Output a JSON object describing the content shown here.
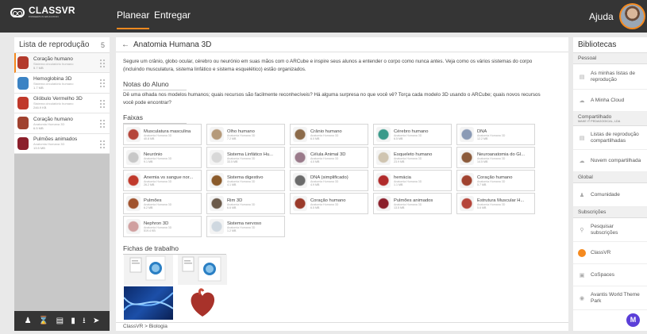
{
  "app": {
    "logo_text": "CLASSVR",
    "logo_subtitle": "PIONEERS IN EDUCATION"
  },
  "nav": {
    "tab_plan": "Planear",
    "tab_deliver": "Entregar",
    "help": "Ajuda"
  },
  "playlist": {
    "title": "Lista de reprodução",
    "count": "5",
    "items": [
      {
        "title": "Coração humano",
        "sub": "Sistema circulatório humano",
        "size": "5.7 MB",
        "color": "#b33a2c"
      },
      {
        "title": "Hemoglobina 3D",
        "sub": "Sistema circulatório humano",
        "size": "1.7 MB",
        "color": "#3b83c4"
      },
      {
        "title": "Glóbulo Vermelho 3D",
        "sub": "Sistema circulatório humano",
        "size": "246.9 KB",
        "color": "#c0392b"
      },
      {
        "title": "Coração humano",
        "sub": "Anatomia Humana 3D",
        "size": "6.5 MB",
        "color": "#a0422f"
      },
      {
        "title": "Pulmões animados",
        "sub": "Anatomia Humana 3D",
        "size": "13.5 MB",
        "color": "#8b1f2b"
      }
    ],
    "toolbar": [
      "person-icon",
      "hourglass-icon",
      "save-icon",
      "trash-icon",
      "download-icon",
      "send-icon"
    ]
  },
  "main": {
    "title": "Anatomia Humana 3D",
    "description": "Segure um crânio, globo ocular, cérebro ou neurónio em suas mãos com o ARCube e inspire seus alunos a entender o corpo como nunca antes. Veja como os vários sistemas do corpo (incluindo musculatura, sistema linfático e sistema esquelético) estão organizados.",
    "notes_title": "Notas do Aluno",
    "notes": "Dê uma olhada nos modelos humanos; quais recursos são facilmente reconhecíveis? Há alguma surpresa no que você vê? Torça cada modelo 3D usando o ARCube; quais novos recursos você pode encontrar?",
    "tracks_title": "Faixas",
    "worksheets_title": "Fichas de trabalho",
    "breadcrumb": "ClassVR > Biologia",
    "tracks": [
      {
        "title": "Musculatura masculina",
        "sub": "Anatomia Humana 3D",
        "size": "40.8 MB",
        "color": "#b5453a"
      },
      {
        "title": "Olho humano",
        "sub": "Anatomia Humana 3D",
        "size": "7.2 MB",
        "color": "#b59a7a"
      },
      {
        "title": "Crânio humano",
        "sub": "Anatomia Humana 3D",
        "size": "6.0 MB",
        "color": "#8c6b4a"
      },
      {
        "title": "Cérebro humano",
        "sub": "Anatomia Humana 3D",
        "size": "6.5 MB",
        "color": "#3a9a8a"
      },
      {
        "title": "DNA",
        "sub": "Anatomia Humana 3D",
        "size": "12.2 MB",
        "color": "#8a9ab5"
      },
      {
        "title": "Neurónio",
        "sub": "Anatomia Humana 3D",
        "size": "9.1 MB",
        "color": "#c8c8c8"
      },
      {
        "title": "Sistema Linfático Hu...",
        "sub": "Anatomia Humana 3D",
        "size": "33.5 MB",
        "color": "#d8d8d8"
      },
      {
        "title": "Célula Animal 3D",
        "sub": "Anatomia Humana 3D",
        "size": "4.0 MB",
        "color": "#9a7a8a"
      },
      {
        "title": "Esqueleto humano",
        "sub": "Anatomia Humana 3D",
        "size": "23.9 MB",
        "color": "#cfc4b0"
      },
      {
        "title": "Neuroanatomia do Gl...",
        "sub": "Anatomia Humana 3D",
        "size": "14.5 MB",
        "color": "#8b5a3a"
      },
      {
        "title": "Anemia vs sangue nor...",
        "sub": "Anatomia Humana 3D",
        "size": "26.2 MB",
        "color": "#c0392b"
      },
      {
        "title": "Sistema digestivo",
        "sub": "Anatomia Humana 3D",
        "size": "4.1 MB",
        "color": "#8a5a2a"
      },
      {
        "title": "DNA (simplificado)",
        "sub": "Anatomia Humana 3D",
        "size": "4.9 MB",
        "color": "#6b6b6b"
      },
      {
        "title": "hemácia",
        "sub": "Anatomia Humana 3D",
        "size": "1.1 MB",
        "color": "#b02a2a"
      },
      {
        "title": "Coração humano",
        "sub": "Anatomia Humana 3D",
        "size": "5.7 MB",
        "color": "#a0422f"
      },
      {
        "title": "Pulmões",
        "sub": "Anatomia Humana 3D",
        "size": "6.2 MB",
        "color": "#a0522d"
      },
      {
        "title": "Rim 3D",
        "sub": "Anatomia Humana 3D",
        "size": "6.6 MB",
        "color": "#6b5a4a"
      },
      {
        "title": "Coração humano",
        "sub": "Anatomia Humana 3D",
        "size": "6.5 MB",
        "color": "#9a3a2a"
      },
      {
        "title": "Pulmões animados",
        "sub": "Anatomia Humana 3D",
        "size": "13.5 MB",
        "color": "#8b1f2b"
      },
      {
        "title": "Estrutura Muscular H...",
        "sub": "Anatomia Humana 3D",
        "size": "5.6 MB",
        "color": "#b5453a"
      },
      {
        "title": "Nephron 3D",
        "sub": "Anatomia Humana 3D",
        "size": "519.4 KB",
        "color": "#d0a0a0"
      },
      {
        "title": "Sistema nervoso",
        "sub": "Anatomia Humana 3D",
        "size": "1.2 MB",
        "color": "#cfd8e0"
      }
    ]
  },
  "libraries": {
    "title": "Bibliotecas",
    "personal": "Pessoal",
    "my_playlists": "As minhas listas de reprodução",
    "my_cloud": "A Minha Cloud",
    "shared": "Compartilhado",
    "shared_sub": "MAKE IT PEDAGOGICAL, LDA",
    "shared_playlists": "Listas de reprodução compartilhadas",
    "shared_cloud": "Nuvem compartilhada",
    "global": "Global",
    "community": "Comunidade",
    "subscriptions": "Subscrições",
    "search_subs": "Pesquisar subscrições",
    "classvr": "ClassVR",
    "cospaces": "CoSpaces",
    "avantis": "Avantis World Theme Park"
  },
  "colors": {
    "accent": "#f58a1f",
    "topbar": "#353535",
    "fab": "#5b3fd8"
  }
}
